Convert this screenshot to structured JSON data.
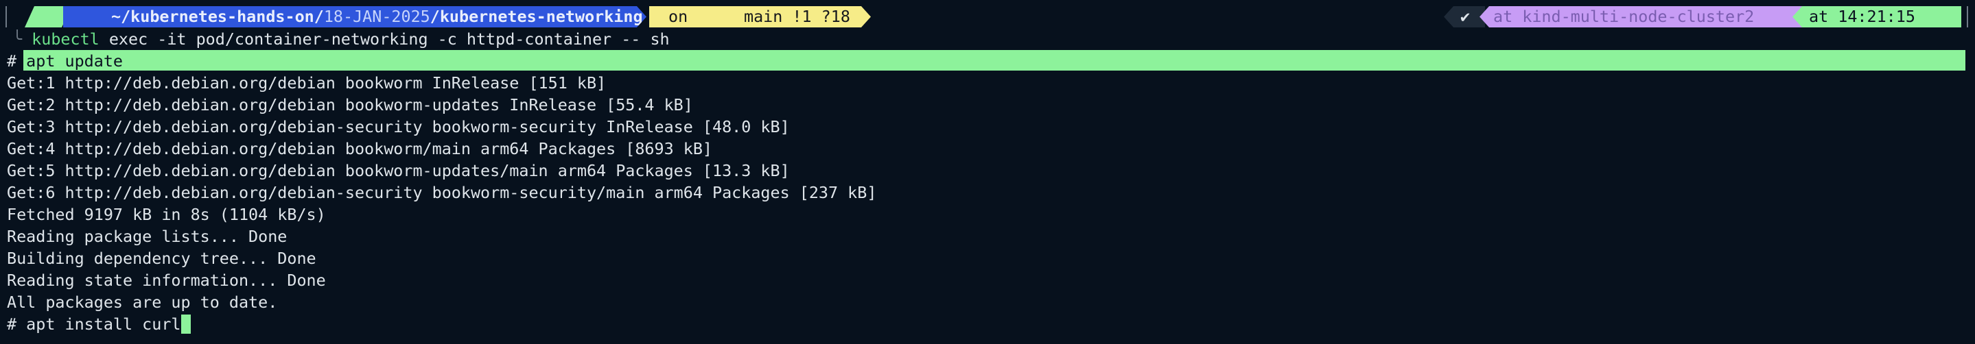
{
  "prompt": {
    "apple_icon": "apple-icon",
    "folder_icon": "folder-icon",
    "path_home": "~",
    "path_repo": "/kubernetes-hands-on/",
    "path_date": "18-JAN-2025",
    "path_sep": "/",
    "path_current": "kubernetes-networking",
    "git_on": "on",
    "git_icon": "github-icon",
    "branch_icon": "git-branch-icon",
    "git_status": "main !1 ?18",
    "status_check": "✔",
    "context_prefix": "at",
    "context_name": "kind-multi-node-cluster2",
    "time_prefix": "at",
    "time": "14:21:15",
    "clock_icon": "clock-icon"
  },
  "command": {
    "kubectl": "kubectl",
    "rest": " exec -it pod/container-networking -c httpd-container -- sh"
  },
  "shell": {
    "prompt_char": "# ",
    "cmd1": "apt update",
    "cmd2": "apt install curl"
  },
  "output": [
    "Get:1 http://deb.debian.org/debian bookworm InRelease [151 kB]",
    "Get:2 http://deb.debian.org/debian bookworm-updates InRelease [55.4 kB]",
    "Get:3 http://deb.debian.org/debian-security bookworm-security InRelease [48.0 kB]",
    "Get:4 http://deb.debian.org/debian bookworm/main arm64 Packages [8693 kB]",
    "Get:5 http://deb.debian.org/debian bookworm-updates/main arm64 Packages [13.3 kB]",
    "Get:6 http://deb.debian.org/debian-security bookworm-security/main arm64 Packages [237 kB]",
    "Fetched 9197 kB in 8s (1104 kB/s)",
    "Reading package lists... Done",
    "Building dependency tree... Done",
    "Reading state information... Done",
    "All packages are up to date."
  ],
  "colors": {
    "background": "#07111d",
    "accent_green": "#8df29b",
    "path_blue": "#2f56dd",
    "git_yellow": "#f6ec88",
    "context_purple": "#c79cf5"
  }
}
